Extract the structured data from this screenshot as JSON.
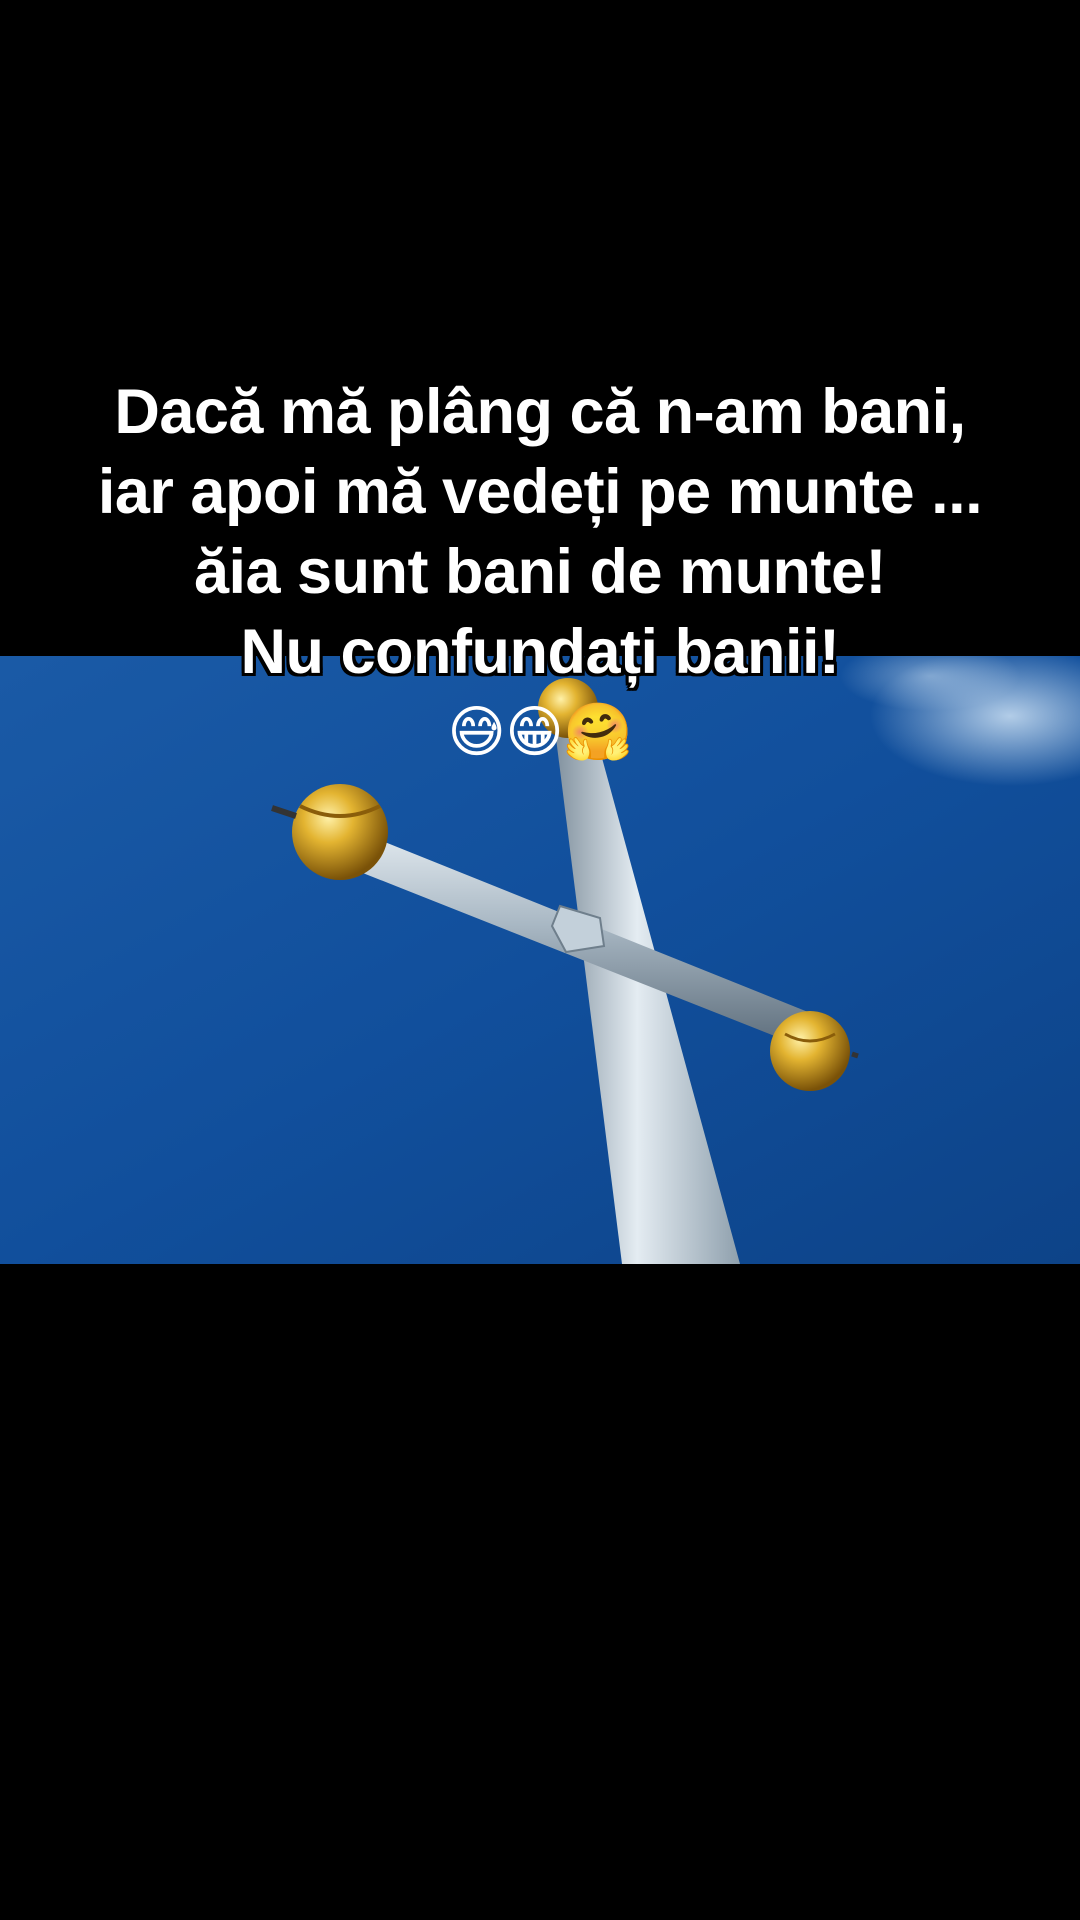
{
  "caption": {
    "line1": "Dacă mă plâng că n-am bani,",
    "line2": "iar apoi mă vedeți pe munte ...",
    "line3": "ăia sunt bani de munte!",
    "line4": "Nu confundați banii!",
    "emojis": "😅😁🤗"
  },
  "photo": {
    "subject": "golden-tipped metal cross against blue sky",
    "colors": {
      "sky": "#0f4e9a",
      "sky_light": "#2a6fb8",
      "metal": "#b9c7d2",
      "gold": "#d4a21c"
    }
  }
}
